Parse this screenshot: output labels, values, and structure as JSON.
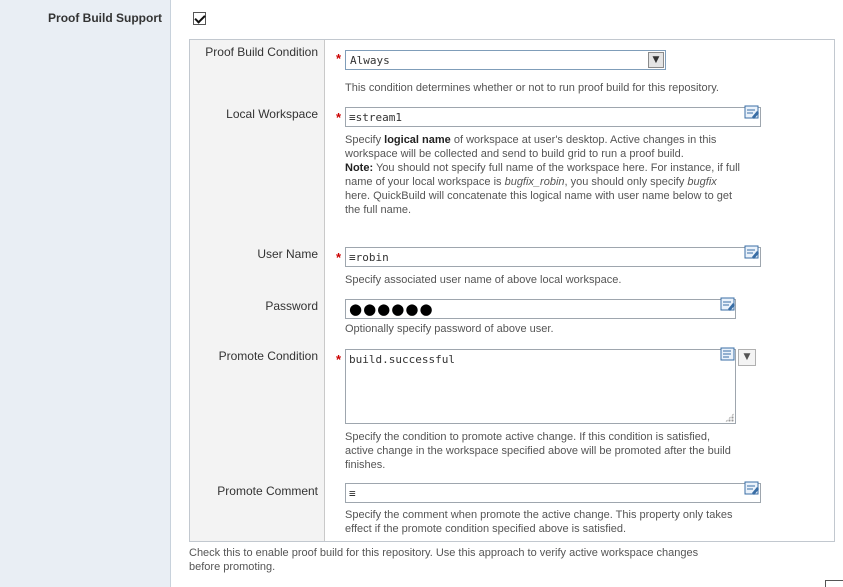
{
  "proof_build_support": {
    "label": "Proof Build Support",
    "checked": true,
    "help": "Check this to enable proof build for this repository. Use this approach to verify active workspace changes before promoting."
  },
  "fields": {
    "proof_build_condition": {
      "label": "Proof Build Condition",
      "value": "Always",
      "help": "This condition determines whether or not to run proof build for this repository."
    },
    "local_workspace": {
      "label": "Local Workspace",
      "value": "stream1",
      "help_1": "Specify ",
      "help_bold": "logical name",
      "help_2": " of workspace at user's desktop. Active changes in this workspace will be collected and send to build grid to run a proof build.",
      "note_label": "Note:",
      "note_1": " You should not specify full name of the workspace here. For instance, if full name of your local workspace is ",
      "note_italic_1": "bugfix_robin",
      "note_2": ", you should only specify ",
      "note_italic_2": "bugfix",
      "note_3": " here. QuickBuild will concatenate this logical name with user name below to get the full name."
    },
    "user_name": {
      "label": "User Name",
      "value": "robin",
      "help": "Specify associated user name of above local workspace."
    },
    "password": {
      "label": "Password",
      "value": "●●●●●●",
      "help": "Optionally specify password of above user."
    },
    "promote_condition": {
      "label": "Promote Condition",
      "value": "build.successful",
      "help": "Specify the condition to promote active change. If this condition is satisfied, active change in the workspace specified above will be promoted after the build finishes."
    },
    "promote_comment": {
      "label": "Promote Comment",
      "value": "",
      "help": "Specify the comment when promote the active change. This property only takes effect if the promote condition specified above is satisfied."
    }
  },
  "required_marker": "*",
  "variable_marker": "≡",
  "icons": {
    "edit": "edit-variable-icon",
    "dropdown": "chevron-down-icon"
  },
  "colors": {
    "label_column_bg": "#e9eef4",
    "required": "#cc0000",
    "field_border": "#9ea6ae"
  }
}
